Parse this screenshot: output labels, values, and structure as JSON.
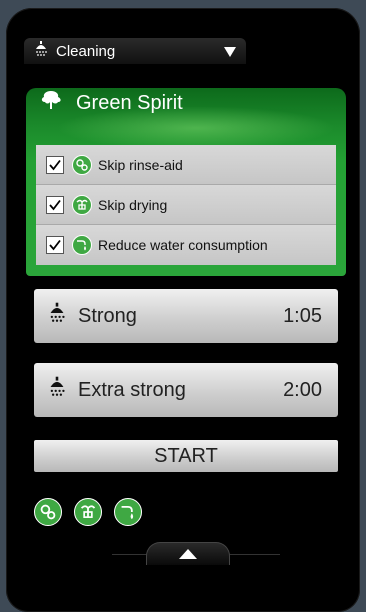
{
  "mode_selector": {
    "label": "Cleaning",
    "icon": "shower-icon"
  },
  "green_spirit": {
    "title": "Green Spirit",
    "icon": "tree-icon",
    "options": [
      {
        "label": "Skip rinse-aid",
        "checked": true,
        "icon": "rinse-aid-icon"
      },
      {
        "label": "Skip drying",
        "checked": true,
        "icon": "drying-icon"
      },
      {
        "label": "Reduce water consumption",
        "checked": true,
        "icon": "water-icon"
      }
    ]
  },
  "programs": [
    {
      "name": "Strong",
      "time": "1:05",
      "icon": "shower-icon"
    },
    {
      "name": "Extra strong",
      "time": "2:00",
      "icon": "shower-icon"
    }
  ],
  "start_label": "START",
  "active_indicators": [
    "rinse-aid-icon",
    "drying-icon",
    "water-icon"
  ],
  "colors": {
    "accent_green": "#2ba53a",
    "badge_green": "#3fa843",
    "panel_gray": "#c9c9c9"
  }
}
